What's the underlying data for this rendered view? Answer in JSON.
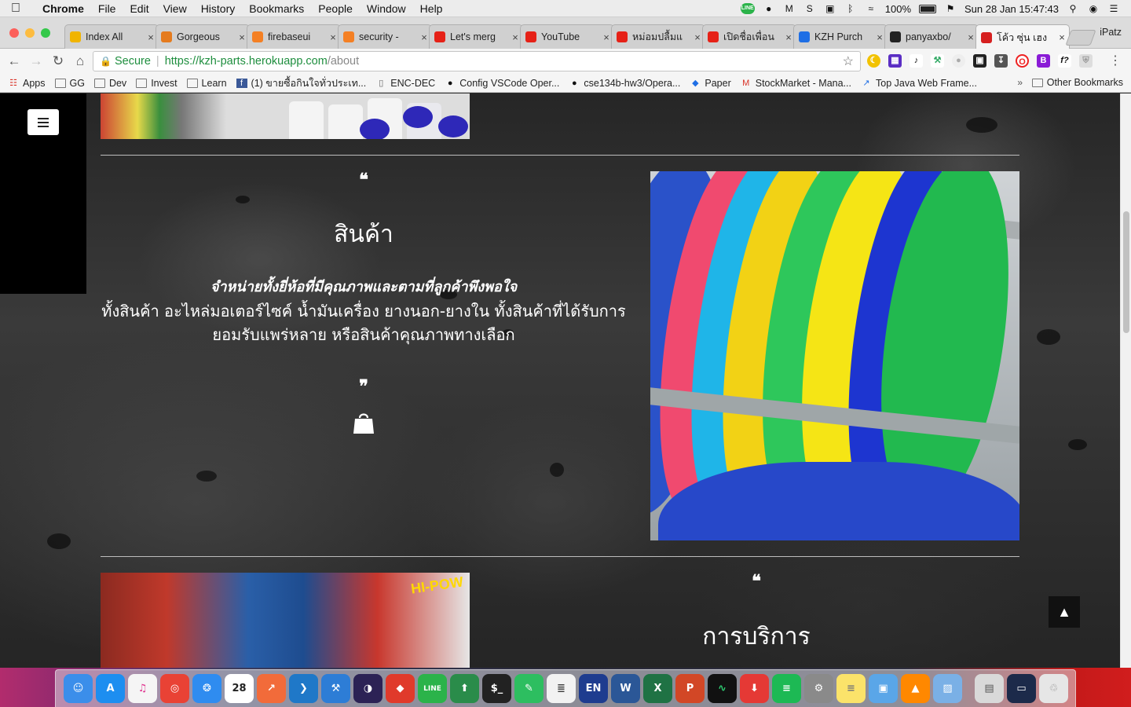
{
  "menubar": {
    "app_name": "Chrome",
    "items": [
      "File",
      "Edit",
      "View",
      "History",
      "Bookmarks",
      "People",
      "Window",
      "Help"
    ],
    "battery": "100%",
    "datetime": "Sun 28 Jan  15:47:43",
    "status_icons": [
      "line-icon",
      "creative-cloud-icon",
      "gmail-icon",
      "skype-icon",
      "display-icon",
      "bluetooth-icon",
      "wifi-icon",
      "battery-icon",
      "flag-us-icon",
      "spotlight-icon",
      "siri-icon",
      "notification-center-icon"
    ]
  },
  "tabs": [
    {
      "title": "Index All",
      "favicon": "index-icon",
      "color": "#f0b400"
    },
    {
      "title": "Gorgeous",
      "favicon": "gorgeous-icon",
      "color": "#e57b1e"
    },
    {
      "title": "firebaseui",
      "favicon": "stackoverflow-icon",
      "color": "#f48024"
    },
    {
      "title": "security -",
      "favicon": "stackoverflow-icon",
      "color": "#f48024"
    },
    {
      "title": "Let's merg",
      "favicon": "youtube-icon",
      "color": "#e62117"
    },
    {
      "title": "YouTube",
      "favicon": "youtube-icon",
      "color": "#e62117"
    },
    {
      "title": "หม่อมปลื้มแ",
      "favicon": "youtube-icon",
      "color": "#e62117"
    },
    {
      "title": "เปิดชื่อเพื่อน",
      "favicon": "youtube-icon",
      "color": "#e62117"
    },
    {
      "title": "KZH Purch",
      "favicon": "dropbox-icon",
      "color": "#1f6fe5"
    },
    {
      "title": "panyaxbo/",
      "favicon": "github-icon",
      "color": "#222222"
    },
    {
      "title": "โค้ว ซุ่น เฮง",
      "favicon": "kzh-icon",
      "color": "#d62020",
      "active": true
    }
  ],
  "profile_name": "iPatz",
  "toolbar": {
    "secure_label": "Secure",
    "url_scheme_host": "https://kzh-parts.herokuapp.com",
    "url_path": "/about"
  },
  "bookmarks": [
    {
      "label": "Apps",
      "icon": "apps-grid-icon"
    },
    {
      "label": "GG",
      "icon": "folder-icon"
    },
    {
      "label": "Dev",
      "icon": "folder-icon"
    },
    {
      "label": "Invest",
      "icon": "folder-icon"
    },
    {
      "label": "Learn",
      "icon": "folder-icon"
    },
    {
      "label": "(1) ขายซื้อกินใจทั่วประเท...",
      "icon": "facebook-icon"
    },
    {
      "label": "ENC-DEC",
      "icon": "page-icon"
    },
    {
      "label": "Config VSCode Oper...",
      "icon": "github-icon"
    },
    {
      "label": "cse134b-hw3/Opera...",
      "icon": "github-icon"
    },
    {
      "label": "Paper",
      "icon": "dropbox-icon"
    },
    {
      "label": "StockMarket - Mana...",
      "icon": "gmail-icon"
    },
    {
      "label": "Top Java Web Frame...",
      "icon": "zeroturnaround-icon"
    }
  ],
  "bookmarks_more": "»",
  "other_bookmarks": "Other Bookmarks",
  "page": {
    "section_products": {
      "quote_open": "❝",
      "title": "สินค้า",
      "subtitle": "จำหน่ายทั้งยี่ห้อที่มีคุณภาพและตามที่ลูกค้าพึงพอใจ",
      "body_line1": "ทั้งสินค้า อะไหล่มอเตอร์ไซค์ น้ำมันเครื่อง ยางนอก-ยางใน ทั้งสินค้าที่ได้รับการ",
      "body_line2": "ยอมรับแพร่หลาย หรือสินค้าคุณภาพทางเลือก",
      "quote_close": "❞"
    },
    "section_services": {
      "quote_open": "❝",
      "title": "การบริการ"
    },
    "bottom_image_text": "HI-POW"
  },
  "dock_apps": [
    "finder-icon",
    "app-store-icon",
    "itunes-icon",
    "chrome-icon",
    "safari-icon",
    "calendar-icon",
    "postman-icon",
    "vscode-icon",
    "xcode-icon",
    "eclipse-icon",
    "git-icon",
    "line-icon",
    "sourcetree-icon",
    "terminal-icon",
    "evernote-icon",
    "textedit-icon",
    "en-dictionary-icon",
    "word-icon",
    "excel-icon",
    "powerpoint-icon",
    "activity-monitor-icon",
    "download-icon",
    "spotify-icon",
    "system-preferences-icon",
    "notes-icon",
    "preview-icon",
    "vlc-icon",
    "photos-icon",
    "screenshot-icon",
    "desktop-icon",
    "trash-icon"
  ],
  "dock_labels": {
    "calendar_day": "28",
    "calendar_month": "JAN",
    "line_badge": "63",
    "en": "EN",
    "word": "W",
    "excel": "X",
    "powerpoint": "P"
  }
}
